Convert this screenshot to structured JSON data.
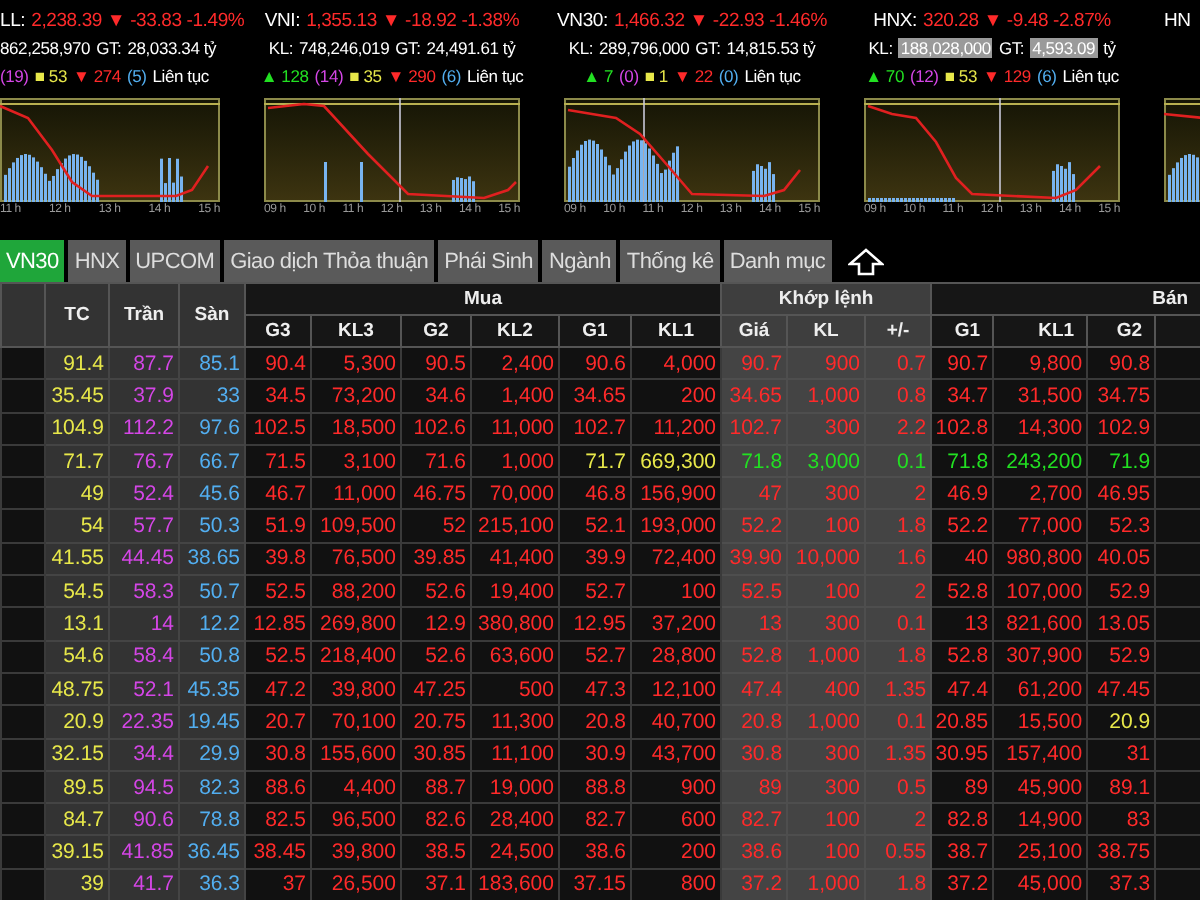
{
  "indices": [
    {
      "name": "LL:",
      "value": "2,238.39 ▼ -33.83 -1.49%",
      "kind": "down",
      "stats": [
        {
          "text": "862,258,970",
          "highlighted": false
        },
        {
          "text": "GT:",
          "highlighted": false
        },
        {
          "text": "28,033.34 tỷ",
          "highlighted": false
        }
      ],
      "breadth": [
        {
          "text": "(19)",
          "kind": "ceil"
        },
        {
          "text": "■ 53",
          "kind": "ref"
        },
        {
          "text": "▼ 274",
          "kind": "down"
        },
        {
          "text": "(5)",
          "kind": "floor"
        },
        {
          "text": "Liên tục",
          "kind": "status"
        }
      ],
      "time_labels": [
        "11 h",
        "12 h",
        "13 h",
        "14 h",
        "15 h"
      ]
    },
    {
      "name": "VNI:",
      "value": "1,355.13 ▼ -18.92 -1.38%",
      "kind": "down",
      "stats": [
        {
          "text": "KL:",
          "highlighted": false
        },
        {
          "text": "748,246,019",
          "highlighted": false
        },
        {
          "text": "GT:",
          "highlighted": false
        },
        {
          "text": "24,491.61 tỷ",
          "highlighted": false
        }
      ],
      "breadth": [
        {
          "text": "▲ 128",
          "kind": "up"
        },
        {
          "text": "(14)",
          "kind": "ceil"
        },
        {
          "text": "■ 35",
          "kind": "ref"
        },
        {
          "text": "▼ 290",
          "kind": "down"
        },
        {
          "text": "(6)",
          "kind": "floor"
        },
        {
          "text": "Liên tục",
          "kind": "status"
        }
      ],
      "time_labels": [
        "09 h",
        "10 h",
        "11 h",
        "12 h",
        "13 h",
        "14 h",
        "15 h"
      ]
    },
    {
      "name": "VN30:",
      "value": "1,466.32 ▼ -22.93 -1.46%",
      "kind": "down",
      "stats": [
        {
          "text": "KL:",
          "highlighted": false
        },
        {
          "text": "289,796,000",
          "highlighted": false
        },
        {
          "text": "GT:",
          "highlighted": false
        },
        {
          "text": "14,815.53 tỷ",
          "highlighted": false
        }
      ],
      "breadth": [
        {
          "text": "▲ 7",
          "kind": "up"
        },
        {
          "text": "(0)",
          "kind": "ceil"
        },
        {
          "text": "■ 1",
          "kind": "ref"
        },
        {
          "text": "▼ 22",
          "kind": "down"
        },
        {
          "text": "(0)",
          "kind": "floor"
        },
        {
          "text": "Liên tục",
          "kind": "status"
        }
      ],
      "time_labels": [
        "09 h",
        "10 h",
        "11 h",
        "12 h",
        "13 h",
        "14 h",
        "15 h"
      ]
    },
    {
      "name": "HNX:",
      "value": "320.28 ▼ -9.48 -2.87%",
      "kind": "down",
      "stats": [
        {
          "text": "KL:",
          "highlighted": false
        },
        {
          "text": "188,028,000",
          "highlighted": true
        },
        {
          "text": "GT:",
          "highlighted": false
        },
        {
          "text": "4,593.09",
          "highlighted": true
        },
        {
          "text": "tỷ",
          "highlighted": false
        }
      ],
      "breadth": [
        {
          "text": "▲ 70",
          "kind": "up"
        },
        {
          "text": "(12)",
          "kind": "ceil"
        },
        {
          "text": "■ 53",
          "kind": "ref"
        },
        {
          "text": "▼ 129",
          "kind": "down"
        },
        {
          "text": "(6)",
          "kind": "floor"
        },
        {
          "text": "Liên tục",
          "kind": "status"
        }
      ],
      "time_labels": [
        "09 h",
        "10 h",
        "11 h",
        "12 h",
        "13 h",
        "14 h",
        "15 h"
      ]
    },
    {
      "name": "HN"
    }
  ],
  "tabs": [
    {
      "label": "VN30",
      "selected": true
    },
    {
      "label": "HNX",
      "selected": false
    },
    {
      "label": "UPCOM",
      "selected": false
    },
    {
      "label": "Giao dịch Thỏa thuận",
      "selected": false
    },
    {
      "label": "Phái Sinh",
      "selected": false
    },
    {
      "label": "Ngành",
      "selected": false
    },
    {
      "label": "Thống kê",
      "selected": false
    },
    {
      "label": "Danh mục",
      "selected": false
    }
  ],
  "table": {
    "fixed_columns": [
      "TC",
      "Trần",
      "Sàn"
    ],
    "groups": [
      {
        "label": "Mua",
        "kind": "bid",
        "columns": [
          "G3",
          "KL3",
          "G2",
          "KL2",
          "G1",
          "KL1"
        ]
      },
      {
        "label": "Khớp lệnh",
        "kind": "match",
        "columns": [
          "Giá",
          "KL",
          "+/-"
        ]
      },
      {
        "label": "Bán",
        "kind": "ask",
        "columns": [
          "G1",
          "KL1",
          "G2"
        ]
      }
    ],
    "rows": [
      {
        "kind": "down",
        "cells": [
          "91.4",
          "87.7",
          "85.1",
          "90.4",
          "5,300",
          "90.5",
          "2,400",
          "90.6",
          "4,000",
          "90.7",
          "900",
          "0.7",
          "90.7",
          "9,800",
          "90.8"
        ]
      },
      {
        "kind": "down",
        "cells": [
          "35.45",
          "37.9",
          "33",
          "34.5",
          "73,200",
          "34.6",
          "1,400",
          "34.65",
          "200",
          "34.65",
          "1,000",
          "0.8",
          "34.7",
          "31,500",
          "34.75"
        ]
      },
      {
        "kind": "down",
        "cells": [
          "104.9",
          "112.2",
          "97.6",
          "102.5",
          "18,500",
          "102.6",
          "11,000",
          "102.7",
          "11,200",
          "102.7",
          "300",
          "2.2",
          "102.8",
          "14,300",
          "102.9"
        ]
      },
      {
        "kind": "down",
        "cells": [
          "71.7",
          "76.7",
          "66.7",
          "71.5",
          "3,100",
          "71.6",
          "1,000",
          {
            "text": "71.7",
            "kind": "ref"
          },
          {
            "text": "669,300",
            "kind": "ref"
          },
          {
            "text": "71.8",
            "kind": "up"
          },
          {
            "text": "3,000",
            "kind": "up"
          },
          {
            "text": "0.1",
            "kind": "up"
          },
          {
            "text": "71.8",
            "kind": "up"
          },
          {
            "text": "243,200",
            "kind": "up"
          },
          {
            "text": "71.9",
            "kind": "up"
          }
        ]
      },
      {
        "kind": "down",
        "cells": [
          "49",
          "52.4",
          "45.6",
          "46.7",
          "11,000",
          "46.75",
          "70,000",
          "46.8",
          "156,900",
          "47",
          "300",
          "2",
          "46.9",
          "2,700",
          "46.95"
        ]
      },
      {
        "kind": "down",
        "cells": [
          "54",
          "57.7",
          "50.3",
          "51.9",
          "109,500",
          "52",
          "215,100",
          "52.1",
          "193,000",
          "52.2",
          "100",
          "1.8",
          "52.2",
          "77,000",
          "52.3"
        ]
      },
      {
        "kind": "down",
        "cells": [
          "41.55",
          "44.45",
          "38.65",
          "39.8",
          "76,500",
          "39.85",
          "41,400",
          "39.9",
          "72,400",
          "39.90",
          "10,000",
          "1.6",
          "40",
          "980,800",
          "40.05"
        ]
      },
      {
        "kind": "down",
        "cells": [
          "54.5",
          "58.3",
          "50.7",
          "52.5",
          "88,200",
          "52.6",
          "19,400",
          "52.7",
          "100",
          "52.5",
          "100",
          "2",
          "52.8",
          "107,000",
          "52.9"
        ]
      },
      {
        "kind": "down",
        "cells": [
          "13.1",
          "14",
          "12.2",
          "12.85",
          "269,800",
          "12.9",
          "380,800",
          "12.95",
          "37,200",
          "13",
          "300",
          "0.1",
          "13",
          "821,600",
          "13.05"
        ]
      },
      {
        "kind": "down",
        "cells": [
          "54.6",
          "58.4",
          "50.8",
          "52.5",
          "218,400",
          "52.6",
          "63,600",
          "52.7",
          "28,800",
          "52.8",
          "1,000",
          "1.8",
          "52.8",
          "307,900",
          "52.9"
        ]
      },
      {
        "kind": "down",
        "cells": [
          "48.75",
          "52.1",
          "45.35",
          "47.2",
          "39,800",
          "47.25",
          "500",
          "47.3",
          "12,100",
          "47.4",
          "400",
          "1.35",
          "47.4",
          "61,200",
          "47.45"
        ]
      },
      {
        "kind": "down",
        "cells": [
          "20.9",
          "22.35",
          "19.45",
          "20.7",
          "70,100",
          "20.75",
          "11,300",
          "20.8",
          "40,700",
          "20.8",
          "1,000",
          "0.1",
          "20.85",
          "15,500",
          {
            "text": "20.9",
            "kind": "ref"
          }
        ]
      },
      {
        "kind": "down",
        "cells": [
          "32.15",
          "34.4",
          "29.9",
          "30.8",
          "155,600",
          "30.85",
          "11,100",
          "30.9",
          "43,700",
          "30.8",
          "300",
          "1.35",
          "30.95",
          "157,400",
          "31"
        ]
      },
      {
        "kind": "down",
        "cells": [
          "89.5",
          "94.5",
          "82.3",
          "88.6",
          "4,400",
          "88.7",
          "19,000",
          "88.8",
          "900",
          "89",
          "300",
          "0.5",
          "89",
          "45,900",
          "89.1"
        ]
      },
      {
        "kind": "down",
        "cells": [
          "84.7",
          "90.6",
          "78.8",
          "82.5",
          "96,500",
          "82.6",
          "28,400",
          "82.7",
          "600",
          "82.7",
          "100",
          "2",
          "82.8",
          "14,900",
          "83"
        ]
      },
      {
        "kind": "down",
        "cells": [
          "39.15",
          "41.85",
          "36.45",
          "38.45",
          "39,800",
          "38.5",
          "24,500",
          "38.6",
          "200",
          "38.6",
          "100",
          "0.55",
          "38.7",
          "25,100",
          "38.75"
        ]
      },
      {
        "kind": "down",
        "cells": [
          "39",
          "41.7",
          "36.3",
          "37",
          "26,500",
          "37.1",
          "183,600",
          "37.15",
          "800",
          "37.2",
          "1,000",
          "1.8",
          "37.2",
          "45,000",
          "37.3"
        ]
      }
    ]
  }
}
